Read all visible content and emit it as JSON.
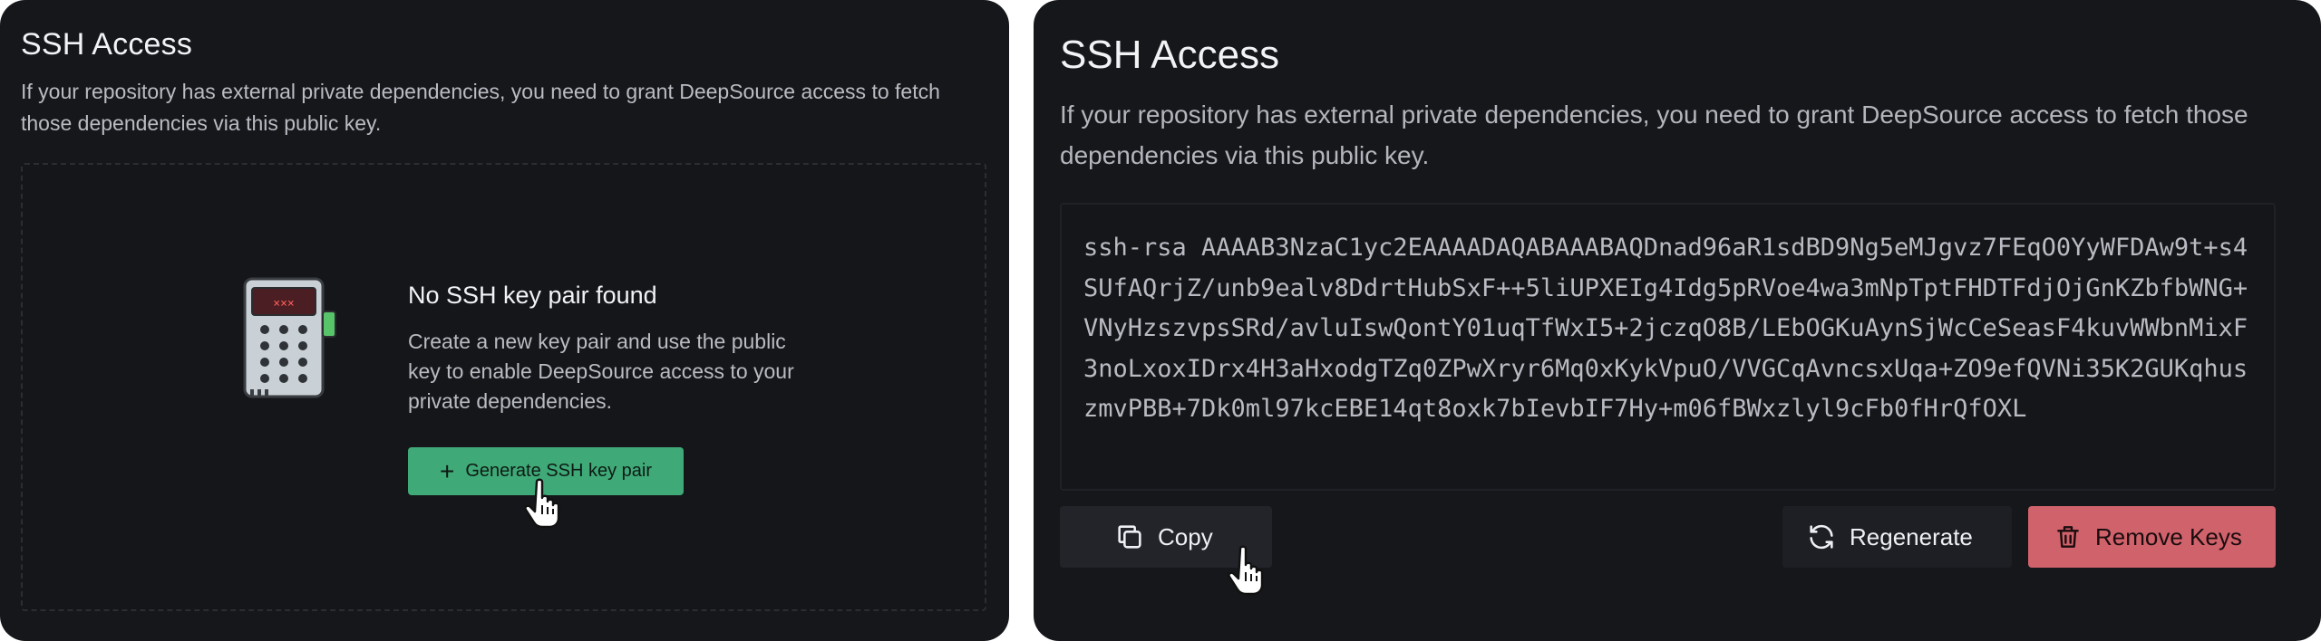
{
  "left_panel": {
    "title": "SSH Access",
    "description": "If your repository has external private dependencies, you need to grant DeepSource access to fetch those dependencies via this public key.",
    "empty_state": {
      "title": "No SSH key pair found",
      "description": "Create a new key pair and use the public key to enable DeepSource access to your private dependencies.",
      "illustration": "keypad-lock-device",
      "button_label": "Generate SSH key pair",
      "button_icon": "plus-icon"
    }
  },
  "right_panel": {
    "title": "SSH Access",
    "description": "If your repository has external private dependencies, you need to grant DeepSource access to fetch those dependencies via this public key.",
    "public_key": "ssh-rsa AAAAB3NzaC1yc2EAAAADAQABAAABAQDnad96aR1sdBD9Ng5eMJgvz7FEqO0YyWFDAw9t+s4SUfAQrjZ/unb9ealv8DdrtHubSxF++5liUPXEIg4Idg5pRVoe4wa3mNpTptFHDTFdjOjGnKZbfbWNG+VNyHzszvpsSRd/avluIswQontY01uqTfWxI5+2jczqO8B/LEbOGKuAynSjWcCeSeasF4kuvWWbnMixF3noLxoxIDrx4H3aHxodgTZq0ZPwXryr6Mq0xKykVpuO/VVGCqAvncsxUqa+ZO9efQVNi35K2GUKqhuszmvPBB+7Dk0ml97kcEBE14qt8oxk7bIevbIF7Hy+m06fBWxzlyl9cFb0fHrQfOXL",
    "buttons": {
      "copy": "Copy",
      "regenerate": "Regenerate",
      "remove": "Remove Keys"
    }
  },
  "colors": {
    "panel_bg": "#16171b",
    "primary_green": "#3fa978",
    "danger_red": "#d0626b",
    "text_primary": "#f2f3f5",
    "text_secondary": "#b9bcc3"
  }
}
